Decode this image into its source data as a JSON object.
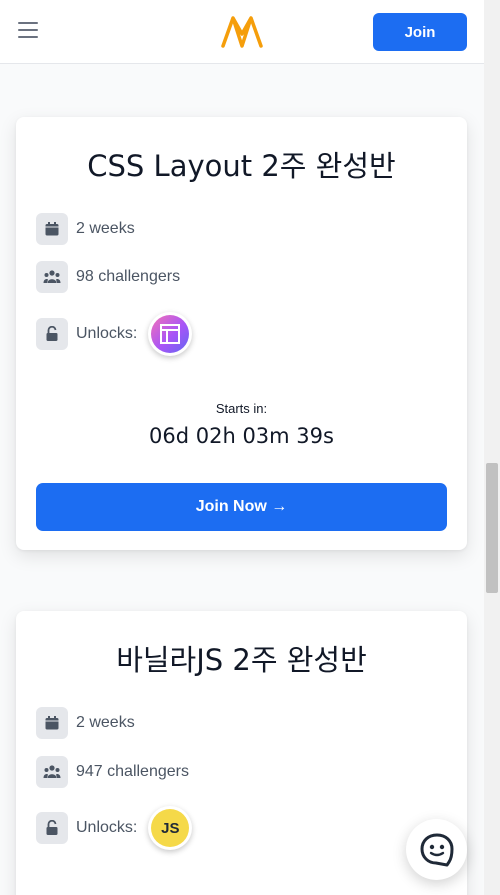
{
  "header": {
    "menu_icon": "hamburger-menu-icon",
    "logo_icon": "brand-logo-icon",
    "join_label": "Join",
    "colors": {
      "primary": "#1c6df2",
      "logo": "#f59e0b"
    }
  },
  "courses": [
    {
      "title": "CSS Layout 2주 완성반",
      "duration": "2 weeks",
      "challengers": "98 challengers",
      "unlocks_label": "Unlocks:",
      "badge_icon": "css-layout-badge-icon",
      "starts_label": "Starts in:",
      "countdown": "06d 02h 03m 39s",
      "join_now_label": "Join Now →"
    },
    {
      "title": "바닐라JS 2주 완성반",
      "duration": "2 weeks",
      "challengers": "947 challengers",
      "unlocks_label": "Unlocks:",
      "badge_icon": "js-badge-icon",
      "badge_text": "JS"
    }
  ],
  "chat": {
    "icon": "chat-bubble-icon"
  }
}
